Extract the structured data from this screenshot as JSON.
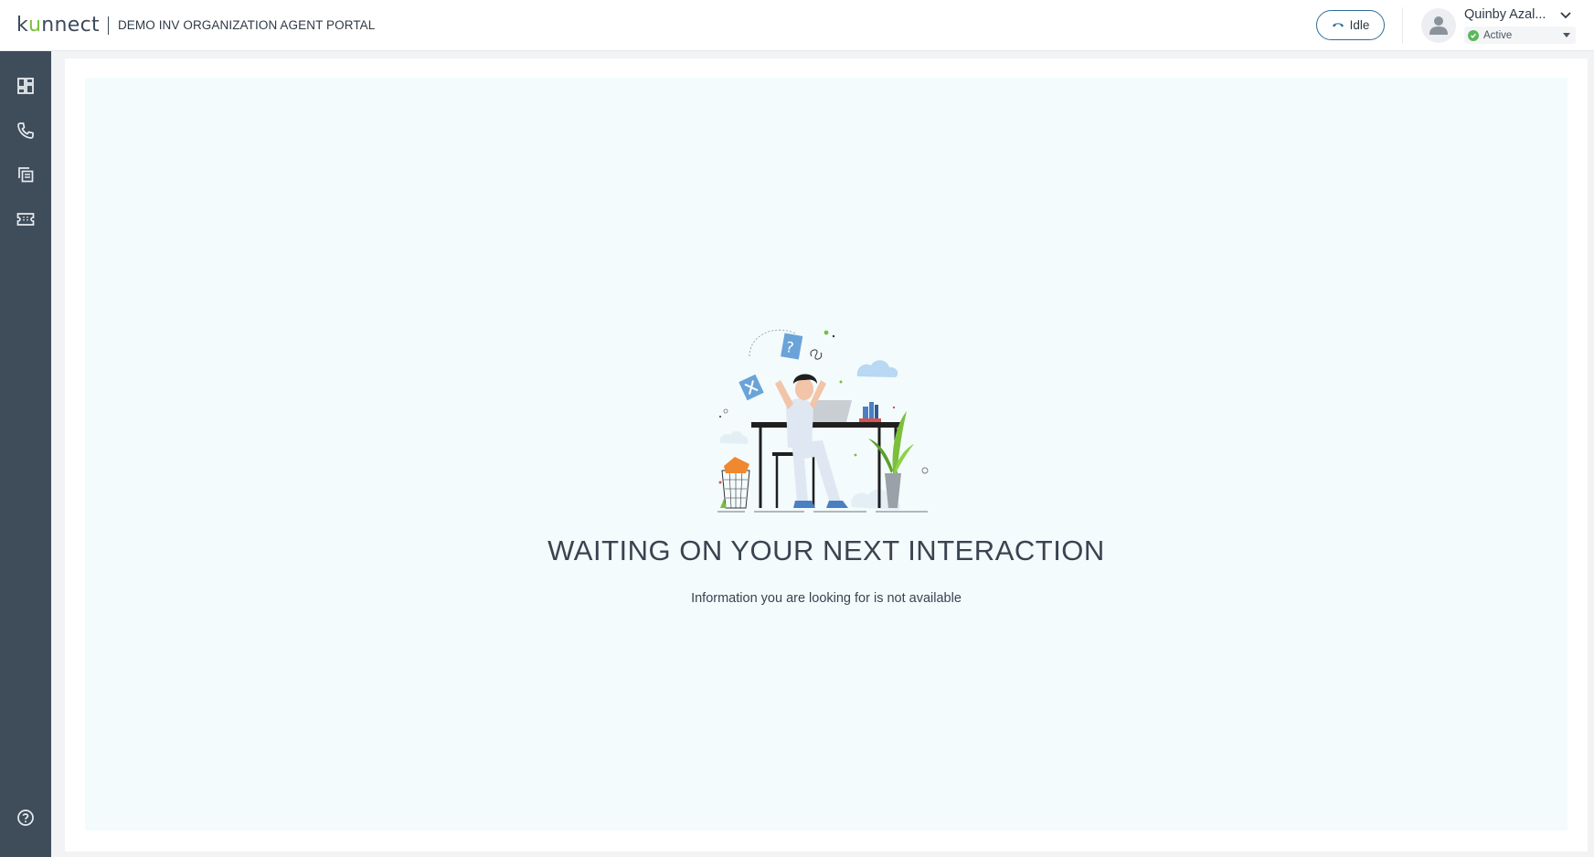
{
  "header": {
    "logo_text_k": "k",
    "logo_text_u": "u",
    "logo_text_rest": "nnect",
    "portal_title": "DEMO INV ORGANIZATION AGENT PORTAL",
    "call_status_label": "Idle",
    "user_name": "Quinby Azal...",
    "presence_status": "Active"
  },
  "sidebar": {
    "items": [
      {
        "icon": "dashboard-icon"
      },
      {
        "icon": "phone-icon"
      },
      {
        "icon": "copy-icon"
      },
      {
        "icon": "ticket-icon"
      },
      {
        "icon": "help-icon"
      }
    ]
  },
  "main": {
    "empty_title": "WAITING ON YOUR NEXT INTERACTION",
    "empty_subtitle": "Information you are looking for is not available"
  },
  "colors": {
    "brand_dark": "#3d4a5a",
    "brand_green": "#7bbf3a",
    "sidebar_bg": "#3f4d5b",
    "content_bg": "#f3fbfd",
    "accent_blue": "#2e6f97",
    "status_active": "#5cb85c"
  }
}
